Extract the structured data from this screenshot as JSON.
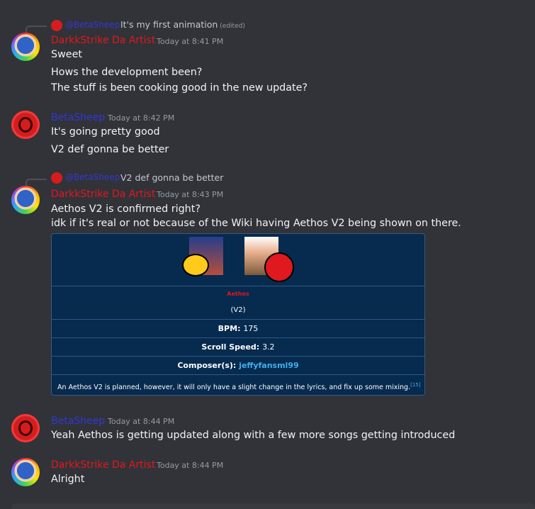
{
  "top_cut_text": "…",
  "messages": [
    {
      "reply": {
        "mention": "@BetaSheep",
        "text": "It's my first animation",
        "edited": "(edited)"
      },
      "author": "DarkkStrike Da Artist",
      "time": "Today at 8:41 PM",
      "lines": [
        "Sweet",
        "Hows the development been?",
        "The stuff is been cooking good in the new update?"
      ]
    },
    {
      "author": "BetaSheep",
      "time": "Today at 8:42 PM",
      "lines": [
        "It's going pretty good",
        "V2 def gonna be better"
      ]
    },
    {
      "reply": {
        "mention": "@BetaSheep",
        "text": "V2 def gonna be better"
      },
      "author": "DarkkStrike Da Artist",
      "time": "Today at 8:43 PM",
      "lines": [
        "Aethos V2 is confirmed right?",
        "idk if it's real or not because of the Wiki having Aethos V2 being shown on there."
      ]
    },
    {
      "author": "BetaSheep",
      "time": "Today at 8:44 PM",
      "lines": [
        "Yeah Aethos is getting updated along with a few more songs getting introduced"
      ]
    },
    {
      "author": "DarkkStrike Da Artist",
      "time": "Today at 8:44 PM",
      "lines": [
        "Alright"
      ]
    }
  ],
  "embed": {
    "song_title": "Aethos",
    "version": "(V2)",
    "bpm_label": "BPM:",
    "bpm_value": "175",
    "scroll_label": "Scroll Speed:",
    "scroll_value": "3.2",
    "composer_label": "Composer(s):",
    "composer_value": "jeffyfansml99",
    "note": "An Aethos V2 is planned, however, it will only have a slight change in the lyrics, and fix up some mixing.",
    "footnote": "[15]"
  },
  "colors": {
    "background": "#313338",
    "dark_name": "#e0181f",
    "sheep_name": "#3436d4",
    "embed_bg": "#072a4f"
  }
}
